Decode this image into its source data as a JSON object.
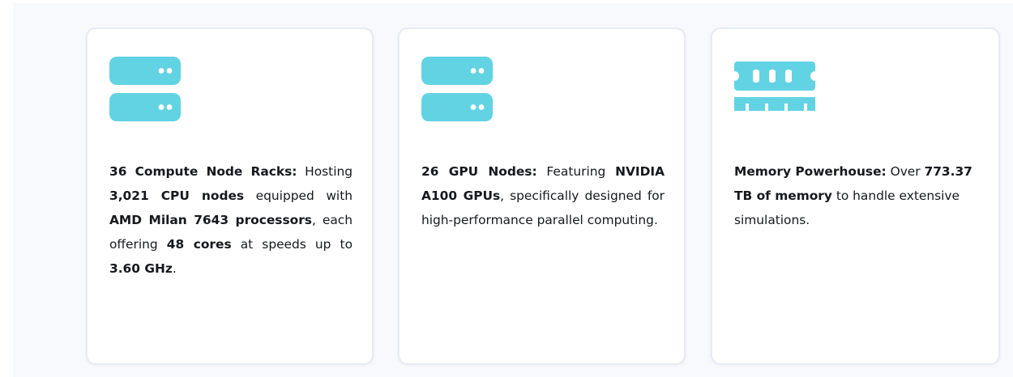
{
  "accent_color": "#62d3e3",
  "cards": [
    {
      "icon": "server-rack-icon",
      "segments": [
        {
          "text": "36 Compute Node Racks:",
          "bold": true
        },
        {
          "text": " Hosting ",
          "bold": false
        },
        {
          "text": "3,021 CPU nodes",
          "bold": true
        },
        {
          "text": " equipped with ",
          "bold": false
        },
        {
          "text": "AMD Milan 7643 processors",
          "bold": true
        },
        {
          "text": ", each offering ",
          "bold": false
        },
        {
          "text": "48 cores",
          "bold": true
        },
        {
          "text": " at speeds up to ",
          "bold": false
        },
        {
          "text": "3.60 GHz",
          "bold": true
        },
        {
          "text": ".",
          "bold": false
        }
      ]
    },
    {
      "icon": "server-rack-icon",
      "segments": [
        {
          "text": "26 GPU Nodes:",
          "bold": true
        },
        {
          "text": " Featuring ",
          "bold": false
        },
        {
          "text": "NVIDIA A100 GPUs",
          "bold": true
        },
        {
          "text": ", specifically designed for high-performance parallel computing.",
          "bold": false
        }
      ]
    },
    {
      "icon": "memory-module-icon",
      "segments": [
        {
          "text": "Memory Powerhouse:",
          "bold": true
        },
        {
          "text": " Over ",
          "bold": false
        },
        {
          "text": "773.37 TB of memory",
          "bold": true
        },
        {
          "text": " to handle extensive simulations.",
          "bold": false
        }
      ]
    }
  ]
}
